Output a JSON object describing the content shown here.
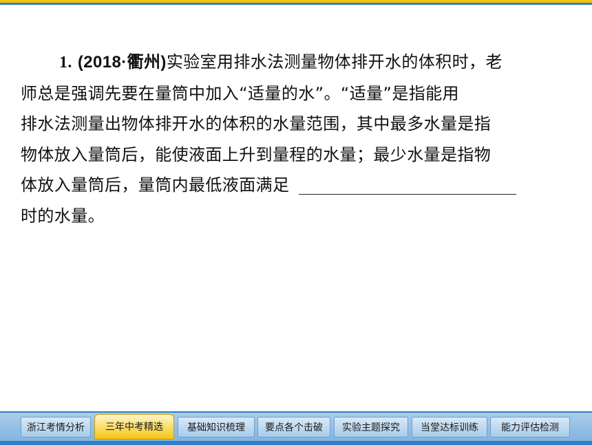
{
  "question": {
    "number": "1.",
    "source": "(2018·衢州)",
    "line1": "实验室用排水法测量物体排开水的体积时，老",
    "line2": "师总是强调先要在量筒中加入“适量的水”。“适量”是指能用",
    "line3": "排水法测量出物体排开水的体积的水量范围，其中最多水量是指",
    "line4": "物体放入量筒后，能使液面上升到量程的水量；最少水量是指物",
    "line5": "体放入量筒后，量筒内最低液面满足",
    "line6": "时的水量。"
  },
  "nav": {
    "tabs": [
      {
        "label": "浙江考情分析"
      },
      {
        "label": "三年中考精选"
      },
      {
        "label": "基础知识梳理"
      },
      {
        "label": "要点各个击破"
      },
      {
        "label": "实验主题探究"
      },
      {
        "label": "当堂达标训练"
      },
      {
        "label": "能力评估检测"
      }
    ],
    "active_index": 1
  },
  "colors": {
    "accent_yellow": "#f4c20d",
    "accent_blue": "#2f7fc8"
  }
}
